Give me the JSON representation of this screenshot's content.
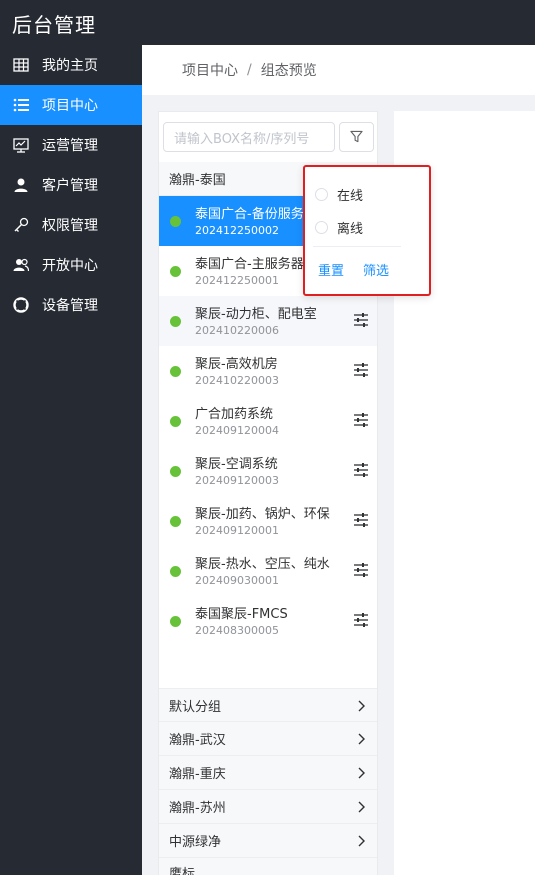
{
  "app": {
    "title": "后台管理"
  },
  "sidebar": {
    "items": [
      {
        "label": "我的主页",
        "icon": "table-icon"
      },
      {
        "label": "项目中心",
        "icon": "list-icon"
      },
      {
        "label": "运营管理",
        "icon": "monitor-chart-icon"
      },
      {
        "label": "客户管理",
        "icon": "user-icon"
      },
      {
        "label": "权限管理",
        "icon": "key-icon"
      },
      {
        "label": "开放中心",
        "icon": "users-icon"
      },
      {
        "label": "设备管理",
        "icon": "lifebuoy-icon"
      }
    ],
    "active_index": 1
  },
  "breadcrumb": {
    "items": [
      "项目中心",
      "组态预览"
    ],
    "separator": "/"
  },
  "search": {
    "placeholder": "请输入BOX名称/序列号"
  },
  "groups": {
    "expanded": {
      "name": "瀚鼎-泰国"
    },
    "collapsed": [
      "默认分组",
      "瀚鼎-武汉",
      "瀚鼎-重庆",
      "瀚鼎-苏州",
      "中源绿净",
      "鹰标"
    ]
  },
  "devices": [
    {
      "name": "泰国广合-备份服务器",
      "serial": "202412250002",
      "status": "online"
    },
    {
      "name": "泰国广合-主服务器",
      "serial": "202412250001",
      "status": "online"
    },
    {
      "name": "聚辰-动力柜、配电室",
      "serial": "202410220006",
      "status": "online"
    },
    {
      "name": "聚辰-高效机房",
      "serial": "202410220003",
      "status": "online"
    },
    {
      "name": "广合加药系统",
      "serial": "202409120004",
      "status": "online"
    },
    {
      "name": "聚辰-空调系统",
      "serial": "202409120003",
      "status": "online"
    },
    {
      "name": "聚辰-加药、锅炉、环保",
      "serial": "202409120001",
      "status": "online"
    },
    {
      "name": "聚辰-热水、空压、纯水",
      "serial": "202409030001",
      "status": "online"
    },
    {
      "name": "泰国聚辰-FMCS",
      "serial": "202408300005",
      "status": "online"
    }
  ],
  "filter_popover": {
    "options": [
      "在线",
      "离线"
    ],
    "reset_label": "重置",
    "confirm_label": "筛选"
  },
  "colors": {
    "sidebar_bg": "#262a33",
    "accent": "#1890ff",
    "online": "#67c23a",
    "highlight_border": "#e02020"
  }
}
